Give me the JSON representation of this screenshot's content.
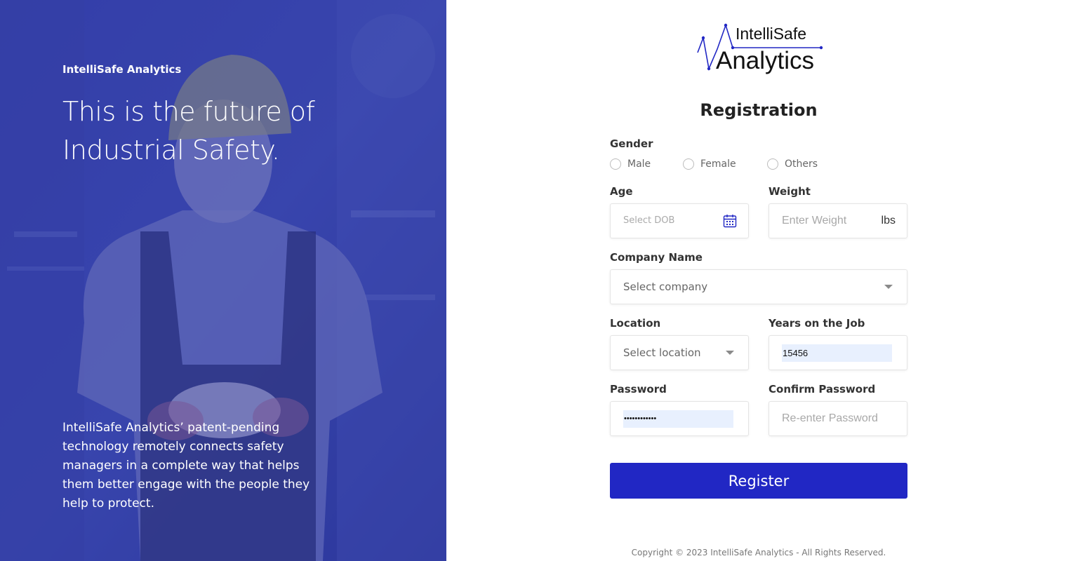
{
  "hero": {
    "brand": "IntelliSafe Analytics",
    "headline": "This is the future of Industrial Safety.",
    "description": "IntelliSafe Analytics’ patent-pending technology remotely connects safety managers in a complete way that helps them better engage with the people they help to protect."
  },
  "logo": {
    "line1": "IntelliSafe",
    "line2": "Analytics"
  },
  "form": {
    "title": "Registration",
    "gender": {
      "label": "Gender",
      "options": [
        "Male",
        "Female",
        "Others"
      ]
    },
    "age": {
      "label": "Age",
      "placeholder": "Select DOB",
      "icon": "calendar-icon"
    },
    "weight": {
      "label": "Weight",
      "placeholder": "Enter Weight",
      "unit": "lbs"
    },
    "company": {
      "label": "Company Name",
      "placeholder": "Select company"
    },
    "location": {
      "label": "Location",
      "placeholder": "Select location"
    },
    "years": {
      "label": "Years on the Job",
      "value": "15456"
    },
    "password": {
      "label": "Password",
      "value": "••••••••••••"
    },
    "confirm_password": {
      "label": "Confirm Password",
      "placeholder": "Re-enter Password"
    },
    "register_label": "Register"
  },
  "footer": {
    "copyright": "Copyright © 2023 IntelliSafe Analytics - All Rights Reserved."
  },
  "colors": {
    "brand_blue": "#2127c4",
    "hero_blue": "#2f3a9e",
    "autofill": "#e8f0fe"
  }
}
